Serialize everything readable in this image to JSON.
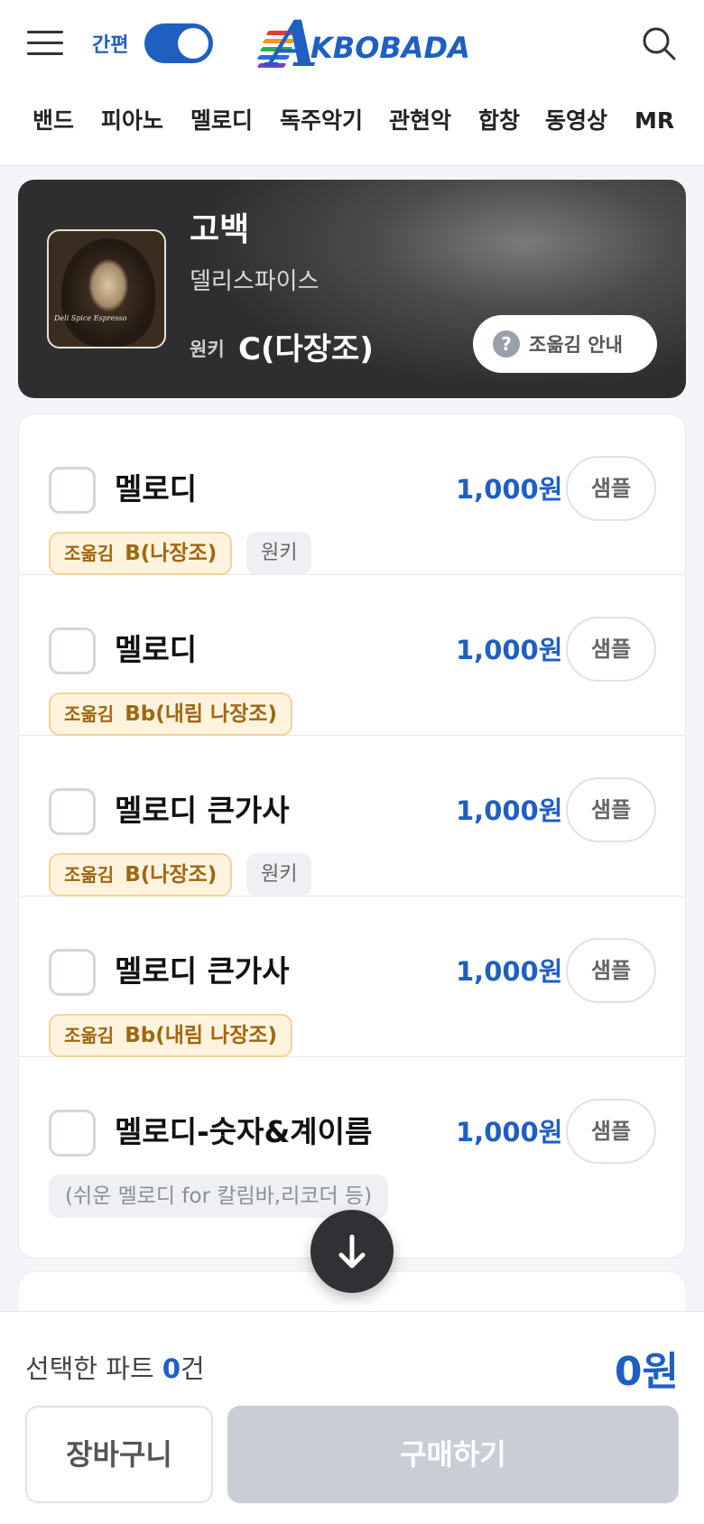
{
  "header": {
    "simple_mode_label": "간편",
    "simple_mode_on": true,
    "logo_text": "KBOBADA",
    "logo_mark": "A",
    "nav": [
      "밴드",
      "피아노",
      "멜로디",
      "독주악기",
      "관현악",
      "합창",
      "동영상",
      "MR"
    ]
  },
  "song": {
    "title": "고백",
    "artist": "델리스파이스",
    "key_label": "원키",
    "key_value": "C(다장조)",
    "guide_button": "조옮김 안내",
    "cover_signature": "Deli Spice  Espresso"
  },
  "items": [
    {
      "name": "멜로디",
      "price": "1,000원",
      "sample": "샘플",
      "trans_prefix": "조옮김",
      "trans_key": "B(나장조)",
      "orig": "원키"
    },
    {
      "name": "멜로디",
      "price": "1,000원",
      "sample": "샘플",
      "trans_prefix": "조옮김",
      "trans_key": "Bb(내림 나장조)"
    },
    {
      "name": "멜로디 큰가사",
      "price": "1,000원",
      "sample": "샘플",
      "trans_prefix": "조옮김",
      "trans_key": "B(나장조)",
      "orig": "원키"
    },
    {
      "name": "멜로디 큰가사",
      "price": "1,000원",
      "sample": "샘플",
      "trans_prefix": "조옮김",
      "trans_key": "Bb(내림 나장조)"
    },
    {
      "name": "멜로디-숫자&계이름",
      "price": "1,000원",
      "sample": "샘플",
      "note": "(쉬운 멜로디 for 칼림바,리코더 등)"
    }
  ],
  "footer": {
    "selected_prefix": "선택한 파트 ",
    "selected_count": "0",
    "selected_suffix": "건",
    "total": "0원",
    "cart_button": "장바구니",
    "buy_button": "구매하기"
  },
  "colors": {
    "accent": "#1f5fc2",
    "badge_bg": "#fff3de",
    "badge_text": "#a0660f",
    "buy_disabled": "#c9ced6"
  }
}
